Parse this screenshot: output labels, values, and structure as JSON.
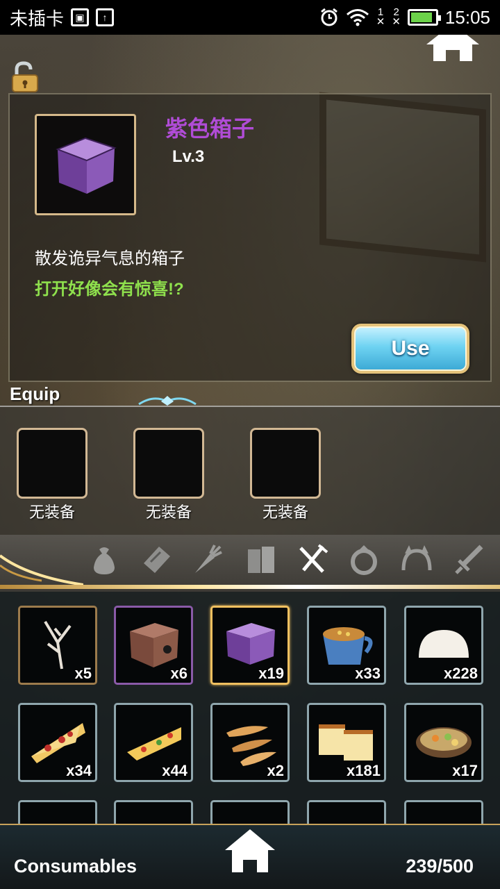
{
  "status_bar": {
    "carrier": "未插卡",
    "time": "15:05",
    "sim1": "1",
    "sim2": "2",
    "battery_level": 0.8
  },
  "item_detail": {
    "name": "紫色箱子",
    "level": "Lv.3",
    "description": "散发诡异气息的箱子",
    "hint": "打开好像会有惊喜!?",
    "use_label": "Use",
    "name_color": "#b04cd6",
    "hint_color": "#8fe14d"
  },
  "equip": {
    "title": "Equip",
    "slots": [
      {
        "label": "无装备"
      },
      {
        "label": "无装备"
      },
      {
        "label": "无装备"
      }
    ]
  },
  "category_tabs": [
    {
      "icon": "bag-icon"
    },
    {
      "icon": "scroll-icon"
    },
    {
      "icon": "carrot-icon"
    },
    {
      "icon": "books-icon"
    },
    {
      "icon": "fork-knife-icon",
      "active": true
    },
    {
      "icon": "ring-icon"
    },
    {
      "icon": "headband-icon"
    },
    {
      "icon": "sword-icon"
    }
  ],
  "inventory": {
    "items": [
      {
        "icon": "branch-icon",
        "qty": "x5"
      },
      {
        "icon": "brown-box-icon",
        "qty": "x6"
      },
      {
        "icon": "purple-box-icon",
        "qty": "x19"
      },
      {
        "icon": "soup-cup-icon",
        "qty": "x33"
      },
      {
        "icon": "bun-icon",
        "qty": "x228"
      },
      {
        "icon": "pizza-slice-icon",
        "qty": "x34"
      },
      {
        "icon": "pizza-slice-cheese-icon",
        "qty": "x44"
      },
      {
        "icon": "potato-wedges-icon",
        "qty": "x2"
      },
      {
        "icon": "cake-icon",
        "qty": "x181"
      },
      {
        "icon": "stew-icon",
        "qty": "x17"
      }
    ]
  },
  "bottom_bar": {
    "category": "Consumables",
    "count": "239/500"
  }
}
